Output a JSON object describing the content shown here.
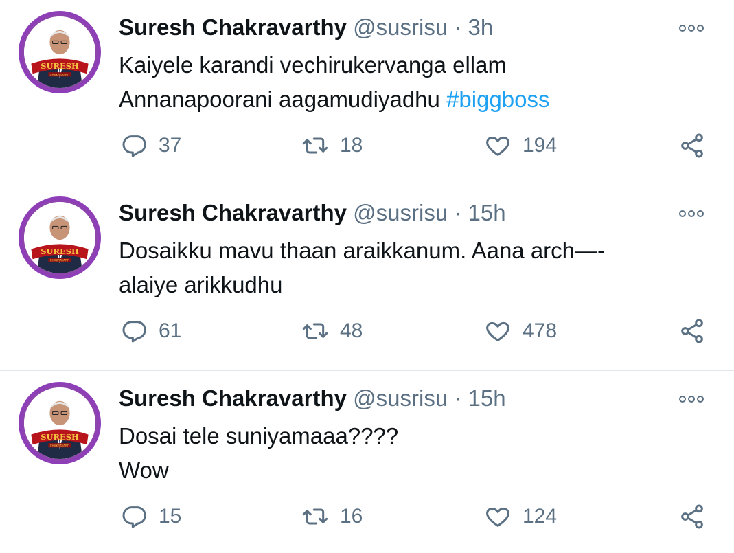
{
  "tweets": [
    {
      "author_name": "Suresh Chakravarthy",
      "handle": "@susrisu",
      "separator": "·",
      "time": "3h",
      "lines": [
        {
          "text": "Kaiyele karandi vechirukervanga ellam",
          "hashtag": ""
        },
        {
          "text": "Annanapoorani aagamudiyadhu ",
          "hashtag": "#biggboss"
        }
      ],
      "replies": "37",
      "retweets": "18",
      "likes": "194"
    },
    {
      "author_name": "Suresh Chakravarthy",
      "handle": "@susrisu",
      "separator": "·",
      "time": "15h",
      "lines": [
        {
          "text": "Dosaikku mavu thaan araikkanum. Aana arch—-",
          "hashtag": ""
        },
        {
          "text": "alaiye arikkudhu",
          "hashtag": ""
        }
      ],
      "replies": "61",
      "retweets": "48",
      "likes": "478"
    },
    {
      "author_name": "Suresh Chakravarthy",
      "handle": "@susrisu",
      "separator": "·",
      "time": "15h",
      "lines": [
        {
          "text": "Dosai tele suniyamaaa????",
          "hashtag": ""
        },
        {
          "text": "Wow",
          "hashtag": ""
        }
      ],
      "replies": "15",
      "retweets": "16",
      "likes": "124"
    }
  ],
  "avatar_badge_text": "SURESH",
  "avatar_badge_subtext": "CHAKRAVARTI",
  "icons": {
    "reply": "reply-icon",
    "retweet": "retweet-icon",
    "like": "heart-icon",
    "share": "share-icon",
    "more": "more-options-icon"
  },
  "colors": {
    "text": "#0f1419",
    "secondary": "#5b7083",
    "link": "#1da1f2",
    "avatar_ring": "#8e3fb8",
    "divider": "#e1e8ed"
  }
}
